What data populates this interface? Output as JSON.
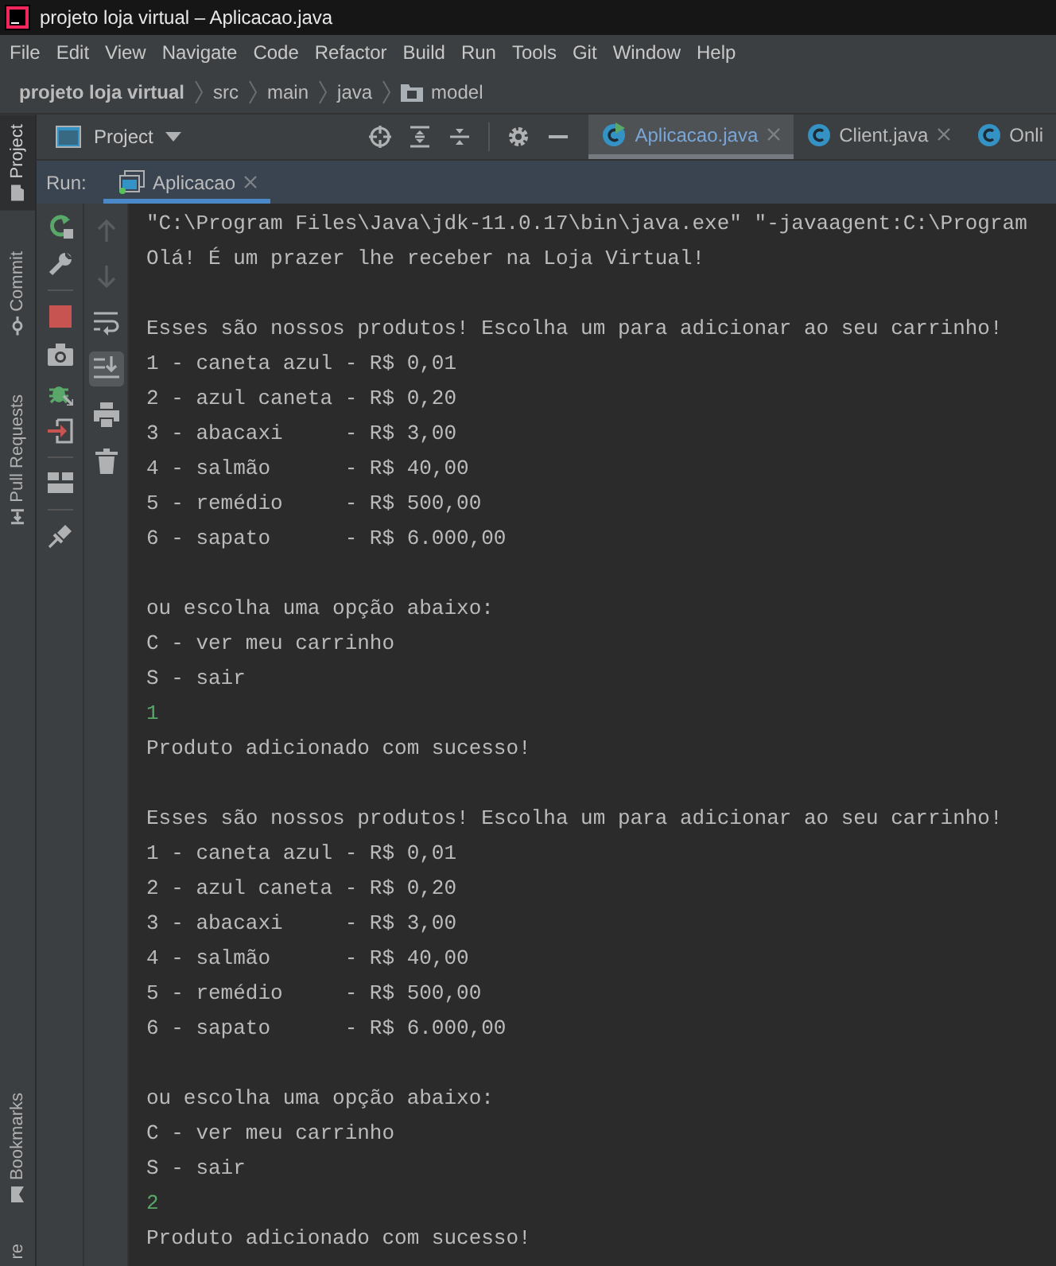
{
  "window": {
    "title": "projeto loja virtual – Aplicacao.java"
  },
  "menu": [
    {
      "label": "File"
    },
    {
      "label": "Edit"
    },
    {
      "label": "View"
    },
    {
      "label": "Navigate"
    },
    {
      "label": "Code"
    },
    {
      "label": "Refactor"
    },
    {
      "label": "Build"
    },
    {
      "label": "Run"
    },
    {
      "label": "Tools"
    },
    {
      "label": "Git"
    },
    {
      "label": "Window"
    },
    {
      "label": "Help"
    }
  ],
  "breadcrumb": [
    {
      "label": "projeto loja virtual",
      "kind": "project"
    },
    {
      "label": "src",
      "kind": "dir"
    },
    {
      "label": "main",
      "kind": "dir"
    },
    {
      "label": "java",
      "kind": "dir"
    },
    {
      "label": "model",
      "kind": "package"
    }
  ],
  "stripe": {
    "top": [
      {
        "label": "Project",
        "kind": "project",
        "selected": true
      },
      {
        "label": "Commit",
        "kind": "commit",
        "selected": false
      },
      {
        "label": "Pull Requests",
        "kind": "pull",
        "selected": false
      }
    ],
    "bottom": [
      {
        "label": "Bookmarks",
        "kind": "bookmark",
        "selected": false
      },
      {
        "label": "re",
        "kind": "none",
        "selected": false
      }
    ]
  },
  "project_panel": {
    "title": "Project"
  },
  "editor_tabs": [
    {
      "label": "Aplicacao.java",
      "selected": true,
      "running": true,
      "closable": true
    },
    {
      "label": "Client.java",
      "selected": false,
      "running": false,
      "closable": true
    },
    {
      "label": "Onli",
      "selected": false,
      "running": false,
      "closable": false
    }
  ],
  "run_panel": {
    "label": "Run:",
    "tabs": [
      {
        "label": "Aplicacao",
        "selected": true
      }
    ]
  },
  "run_toolbar": [
    {
      "kind": "rerun"
    },
    {
      "kind": "wrench"
    },
    {
      "kind": "sep"
    },
    {
      "kind": "stop"
    },
    {
      "kind": "camera"
    },
    {
      "kind": "bug"
    },
    {
      "kind": "exit"
    },
    {
      "kind": "sep"
    },
    {
      "kind": "layout"
    },
    {
      "kind": "sep"
    },
    {
      "kind": "pin"
    }
  ],
  "console_toolbar": [
    {
      "kind": "up",
      "disabled": true,
      "on": false
    },
    {
      "kind": "down",
      "disabled": true,
      "on": false
    },
    {
      "kind": "wrap",
      "disabled": false,
      "on": false
    },
    {
      "kind": "scroll",
      "disabled": false,
      "on": true
    },
    {
      "kind": "print",
      "disabled": false,
      "on": false
    },
    {
      "kind": "trash",
      "disabled": false,
      "on": false
    }
  ],
  "console": {
    "blocks": [
      [
        {
          "text": "\"C:\\Program Files\\Java\\jdk-11.0.17\\bin\\java.exe\" \"-javaagent:C:\\Program",
          "kind": "command"
        },
        {
          "text": "Olá! É um prazer lhe receber na Loja Virtual!",
          "kind": "output"
        }
      ],
      [
        {
          "text": "Esses são nossos produtos! Escolha um para adicionar ao seu carrinho!",
          "kind": "output"
        },
        {
          "text": "1 - caneta azul - R$ 0,01",
          "kind": "output"
        },
        {
          "text": "2 - azul caneta - R$ 0,20",
          "kind": "output"
        },
        {
          "text": "3 - abacaxi     - R$ 3,00",
          "kind": "output"
        },
        {
          "text": "4 - salmão      - R$ 40,00",
          "kind": "output"
        },
        {
          "text": "5 - remédio     - R$ 500,00",
          "kind": "output"
        },
        {
          "text": "6 - sapato      - R$ 6.000,00",
          "kind": "output"
        }
      ],
      [
        {
          "text": "ou escolha uma opção abaixo:",
          "kind": "output"
        },
        {
          "text": "C - ver meu carrinho",
          "kind": "output"
        },
        {
          "text": "S - sair",
          "kind": "output"
        },
        {
          "text": "1",
          "kind": "input"
        },
        {
          "text": "Produto adicionado com sucesso!",
          "kind": "output"
        }
      ],
      [
        {
          "text": "Esses são nossos produtos! Escolha um para adicionar ao seu carrinho!",
          "kind": "output"
        },
        {
          "text": "1 - caneta azul - R$ 0,01",
          "kind": "output"
        },
        {
          "text": "2 - azul caneta - R$ 0,20",
          "kind": "output"
        },
        {
          "text": "3 - abacaxi     - R$ 3,00",
          "kind": "output"
        },
        {
          "text": "4 - salmão      - R$ 40,00",
          "kind": "output"
        },
        {
          "text": "5 - remédio     - R$ 500,00",
          "kind": "output"
        },
        {
          "text": "6 - sapato      - R$ 6.000,00",
          "kind": "output"
        }
      ],
      [
        {
          "text": "ou escolha uma opção abaixo:",
          "kind": "output"
        },
        {
          "text": "C - ver meu carrinho",
          "kind": "output"
        },
        {
          "text": "S - sair",
          "kind": "output"
        },
        {
          "text": "2",
          "kind": "input"
        },
        {
          "text": "Produto adicionado com sucesso!",
          "kind": "output"
        }
      ]
    ]
  }
}
